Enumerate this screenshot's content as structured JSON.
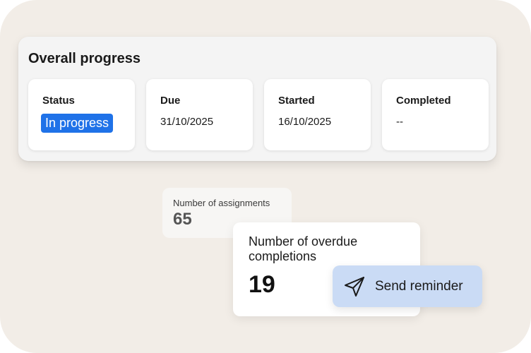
{
  "overall_progress": {
    "title": "Overall progress",
    "cards": {
      "status": {
        "label": "Status",
        "value": "In progress"
      },
      "due": {
        "label": "Due",
        "value": "31/10/2025"
      },
      "started": {
        "label": "Started",
        "value": "16/10/2025"
      },
      "completed": {
        "label": "Completed",
        "value": "--"
      }
    }
  },
  "assignments": {
    "label": "Number of assignments",
    "value": "65"
  },
  "overdue": {
    "label": "Number of overdue completions",
    "value": "19"
  },
  "reminder": {
    "label": "Send reminder",
    "icon": "send-icon"
  },
  "colors": {
    "background": "#f2ede7",
    "status_pill": "#1f72e8",
    "reminder_button": "#cadbf5"
  }
}
